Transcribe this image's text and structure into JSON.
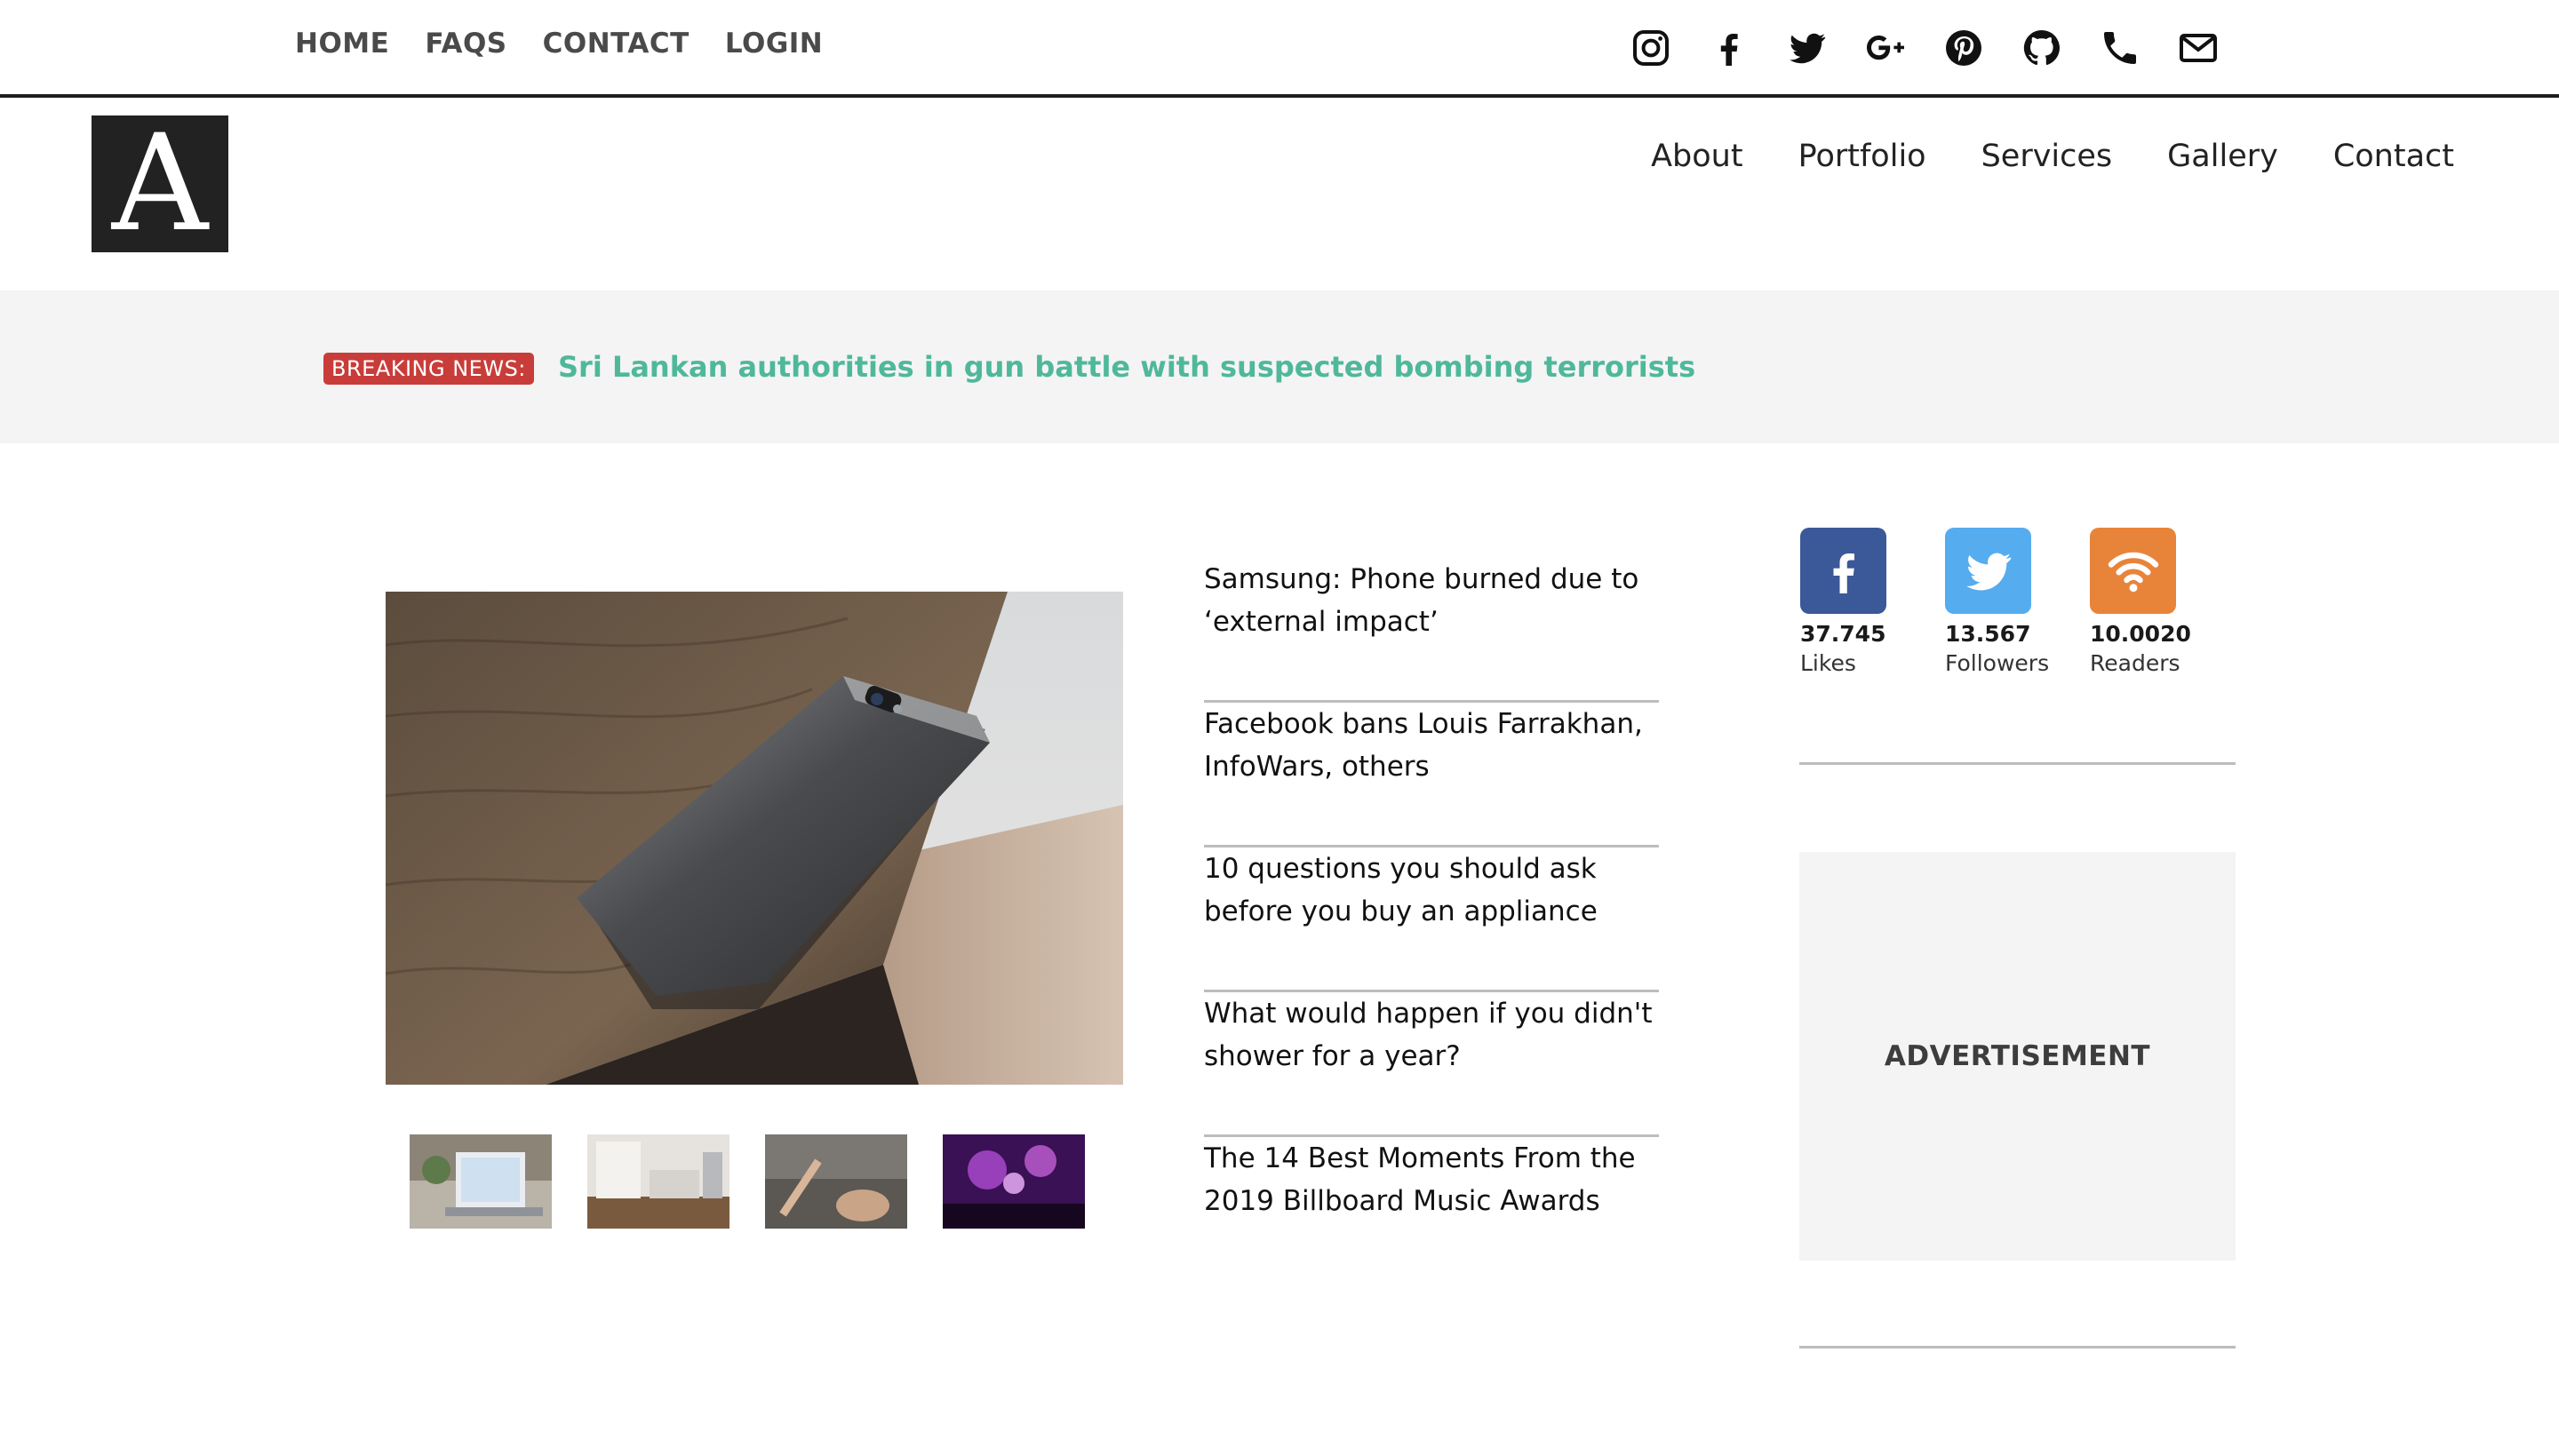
{
  "top_nav": [
    "HOME",
    "FAQS",
    "CONTACT",
    "LOGIN"
  ],
  "top_social_icons": [
    "instagram-icon",
    "facebook-icon",
    "twitter-icon",
    "google-plus-icon",
    "pinterest-icon",
    "github-icon",
    "phone-icon",
    "mail-icon"
  ],
  "logo": {
    "letter": "A"
  },
  "main_nav": [
    "About",
    "Portfolio",
    "Services",
    "Gallery",
    "Contact"
  ],
  "breaking": {
    "badge": "BREAKING NEWS:",
    "headline": "Sri Lankan authorities in gun battle with suspected bombing terrorists"
  },
  "articles": [
    "Samsung: Phone burned due to ‘external impact’",
    "Facebook bans Louis Farrakhan, InfoWars, others",
    "10 questions you should ask before you buy an appliance",
    "What would happen if you didn't shower for a year?",
    "The 14 Best Moments From the 2019 Billboard Music Awards"
  ],
  "counters": [
    {
      "icon": "facebook-icon",
      "count": "37.745",
      "label": "Likes",
      "color": "#3b5998"
    },
    {
      "icon": "twitter-icon",
      "count": "13.567",
      "label": "Followers",
      "color": "#55acee"
    },
    {
      "icon": "rss-icon",
      "count": "10.0020",
      "label": "Readers",
      "color": "#e8843a"
    }
  ],
  "advertisement": "ADVERTISEMENT",
  "colors": {
    "badge": "#c83d3a",
    "headline": "#4fb89a",
    "breaking_bg": "#f4f4f4",
    "logo_bg": "#222222"
  }
}
